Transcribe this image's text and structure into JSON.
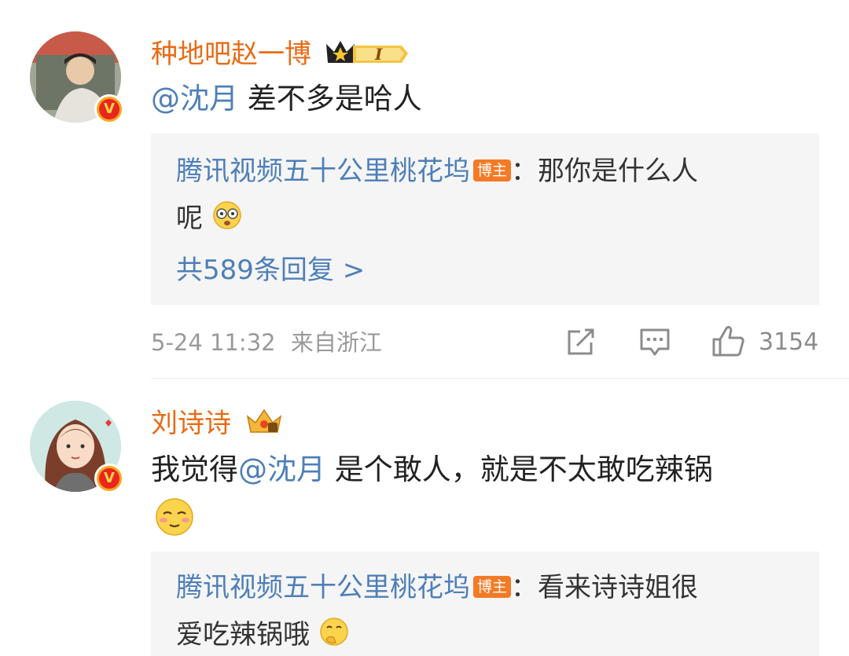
{
  "comments": [
    {
      "username": "种地吧赵一博",
      "level": "I",
      "mention": "@沈月",
      "text_after": " 差不多是哈人",
      "reply": {
        "author": "腾讯视频五十公里桃花坞",
        "badge": "博主",
        "line1": "：那你是什么人",
        "line2": "呢"
      },
      "more_replies": "共589条回复 >",
      "time": "5-24 11:32",
      "location": "来自浙江",
      "likes": "3154"
    },
    {
      "username": "刘诗诗",
      "text_before": "我觉得",
      "mention": "@沈月",
      "text_after": " 是个敢人，就是不太敢吃辣锅",
      "reply": {
        "author": "腾讯视频五十公里桃花坞",
        "badge": "博主",
        "line1": "：看来诗诗姐很",
        "line2": "爱吃辣锅哦"
      }
    }
  ],
  "colors": {
    "username": "#e86b16",
    "link": "#4e7fb8",
    "reply_bg": "#f5f5f5",
    "meta": "#9a9a9a"
  }
}
